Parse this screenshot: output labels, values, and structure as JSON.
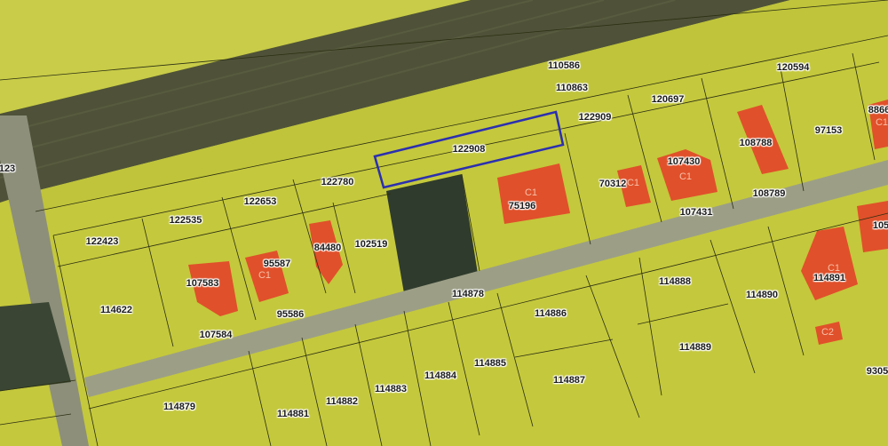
{
  "map": {
    "colors": {
      "parcel_fill": "#c9cc3e",
      "building": "#e0502a",
      "selected_outline": "#2b2fb0",
      "road": "#9c9f86",
      "field_dark": "#4f5238"
    },
    "selected_parcel": "122908",
    "parcels": [
      "110586",
      "120594",
      "110863",
      "120697",
      "122909",
      "122908",
      "8866",
      "97153",
      "108788",
      "122780",
      "122653",
      "122535",
      "122423",
      "102519",
      "84480",
      "95587",
      "107583",
      "114622",
      "95586",
      "107584",
      "75196",
      "70312",
      "107430",
      "108789",
      "107431",
      "114878",
      "114888",
      "114886",
      "114890",
      "114891",
      "105",
      "114889",
      "114885",
      "114887",
      "114884",
      "114883",
      "114882",
      "114881",
      "114879",
      "9305",
      "123"
    ],
    "building_classes": [
      "C1",
      "C1",
      "C1",
      "C1",
      "C1",
      "C1",
      "C2"
    ]
  }
}
